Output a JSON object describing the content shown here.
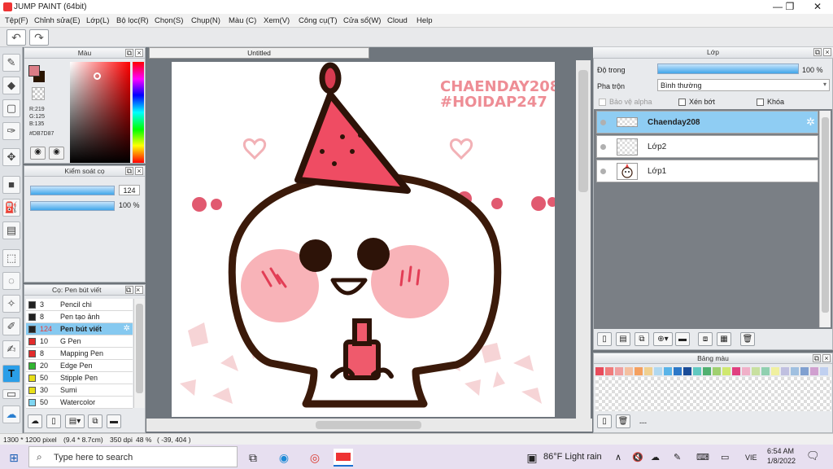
{
  "window": {
    "title": "JUMP PAINT (64bit)",
    "minimize": "—",
    "maximize": "❐",
    "close": "✕"
  },
  "menu": [
    "Tệp(F)",
    "Chỉnh sửa(E)",
    "Lớp(L)",
    "Bộ lọc(R)",
    "Chọn(S)",
    "Chụp(N)",
    "Màu (C)",
    "Xem(V)",
    "Công cụ(T)",
    "Cửa sổ(W)",
    "Cloud",
    "Help"
  ],
  "quick": {
    "undo": "↶",
    "redo": "↷"
  },
  "tools": [
    "✎",
    "◆",
    "▢",
    "✑",
    "✥",
    "■",
    "⛽",
    "▤",
    "⬚",
    "◌",
    "✧",
    "✐",
    "✍",
    "T",
    "▭",
    "☁"
  ],
  "color_panel": {
    "title": "Màu",
    "r": "R:219",
    "g": "G:125",
    "b": "B:135",
    "hex": "#DB7D87",
    "current": "#DB7D87"
  },
  "brush_control": {
    "title": "Kiểm soát cọ",
    "size": "124",
    "opacity": "100 %"
  },
  "tool_list": {
    "title": "Cọ: Pen bút viết",
    "items": [
      {
        "size": "3",
        "name": "Pencil chì",
        "color": "#222222"
      },
      {
        "size": "8",
        "name": "Pen tạo ảnh",
        "color": "#222222"
      },
      {
        "size": "124",
        "name": "Pen bút viết",
        "color": "#222222"
      },
      {
        "size": "10",
        "name": "G Pen",
        "color": "#e22b2b"
      },
      {
        "size": "8",
        "name": "Mapping Pen",
        "color": "#e22b2b"
      },
      {
        "size": "20",
        "name": "Edge Pen",
        "color": "#31b531"
      },
      {
        "size": "50",
        "name": "Stipple Pen",
        "color": "#e8df18"
      },
      {
        "size": "30",
        "name": "Sumi",
        "color": "#e8df18"
      },
      {
        "size": "50",
        "name": "Watercolor",
        "color": "#7fd6f2"
      }
    ]
  },
  "document": {
    "tab": "Untitled"
  },
  "artwork": {
    "line1": "CHAENDAY208",
    "line2": "#HOIDAP247"
  },
  "layers": {
    "title": "Lớp",
    "opacity_label": "Độ trong",
    "opacity_value": "100 %",
    "blend_label": "Pha trộn",
    "blend_value": "Bình thường",
    "protect_alpha": "Bảo vệ alpha",
    "clip": "Xén bớt",
    "lock": "Khóa",
    "items": [
      {
        "name": "Chaenday208"
      },
      {
        "name": "Lớp2"
      },
      {
        "name": "Lớp1"
      }
    ]
  },
  "palette": {
    "title": "Bảng màu",
    "footer": "---",
    "colors": [
      "#e84c5c",
      "#f07c7c",
      "#f0a0a0",
      "#f4c0a0",
      "#f4a060",
      "#f0d090",
      "#b0d8f0",
      "#5ab4e8",
      "#2c78c8",
      "#1a4c98",
      "#60c8c0",
      "#50b070",
      "#a0d070",
      "#d0e870",
      "#e04080",
      "#f0b0c8",
      "#c8e0a0",
      "#90d0b0",
      "#f0f0a0",
      "#c0c0e0",
      "#a0c0e0",
      "#80a0d0",
      "#d0a0d0",
      "#c0d0f0"
    ]
  },
  "status": {
    "size": "1300 * 1200 pixel",
    "cm": "(9.4 * 8.7cm)",
    "dpi": "350 dpi",
    "zoom": "48 %",
    "pos": "( -39, 404 )"
  },
  "taskbar": {
    "search_placeholder": "Type here to search",
    "weather": "86°F  Light rain",
    "lang": "VIE",
    "time": "6:54 AM",
    "date": "1/8/2022"
  }
}
